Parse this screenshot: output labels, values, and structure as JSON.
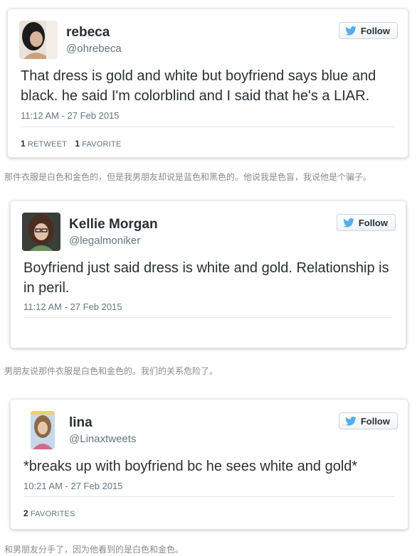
{
  "tweets": [
    {
      "name": "rebeca",
      "handle": "@ohrebeca",
      "follow_label": "Follow",
      "text": "That dress is gold and white but boyfriend says blue and black. he said I'm colorblind and I said that he's a LIAR.",
      "timestamp": "11:12 AM - 27 Feb 2015",
      "retweets_count": "1",
      "retweets_label": "RETWEET",
      "favorites_count": "1",
      "favorites_label": "FAVORITE"
    },
    {
      "name": "Kellie Morgan",
      "handle": "@legalmoniker",
      "follow_label": "Follow",
      "text": "Boyfriend just said dress is white and gold. Relationship is in peril.",
      "timestamp": "11:12 AM - 27 Feb 2015"
    },
    {
      "name": "lina",
      "handle": "@Linaxtweets",
      "follow_label": "Follow",
      "text": "*breaks up with boyfriend bc he sees white and gold*",
      "timestamp": "10:21 AM - 27 Feb 2015",
      "favorites_count": "2",
      "favorites_label": "FAVORITES"
    }
  ],
  "captions": [
    "那件衣服是白色和金色的，但是我男朋友却说是蓝色和黑色的。他说我是色盲，我说他是个骗子。",
    "男朋友说那件衣服是白色和金色的。我们的关系危险了。",
    "和男朋友分手了，因为他看到的是白色和金色。"
  ],
  "colors": {
    "twitter_blue": "#55acee",
    "text": "#292f33",
    "muted": "#66757f",
    "border": "#e1e8ed"
  },
  "icons": [
    "twitter-bird-icon"
  ]
}
